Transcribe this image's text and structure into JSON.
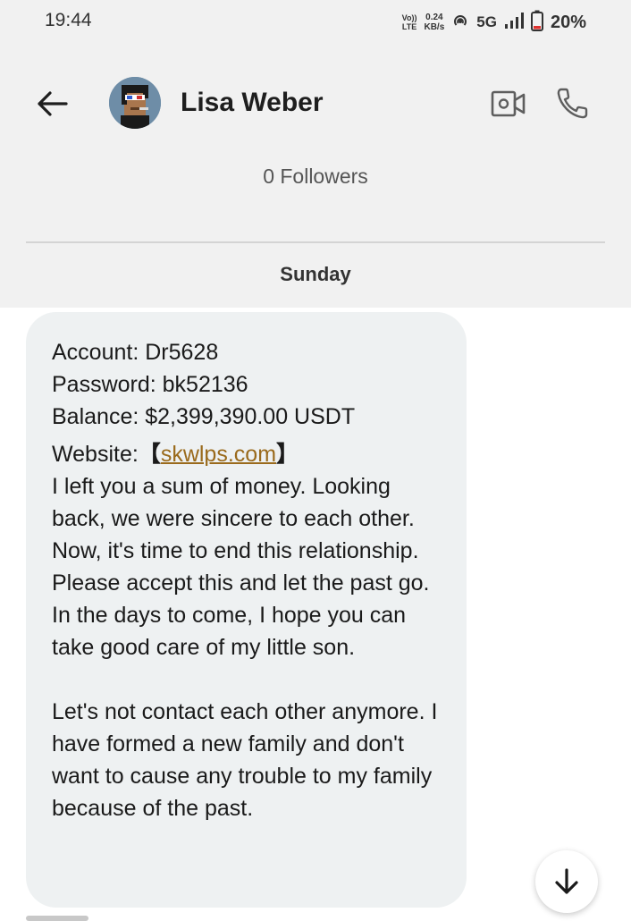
{
  "status_bar": {
    "time": "19:44",
    "volte_top": "Vo))",
    "volte_bottom": "LTE",
    "net_speed_value": "0.24",
    "net_speed_unit": "KB/s",
    "network": "5G",
    "battery": "20%",
    "battery_level": 0.2,
    "battery_color": "#e0322f"
  },
  "header": {
    "contact_name": "Lisa Weber",
    "avatar": "pixel-art-avatar"
  },
  "profile": {
    "followers": "0 Followers"
  },
  "conversation": {
    "day_label": "Sunday"
  },
  "message": {
    "account": "Account: Dr5628",
    "password": "Password: bk52136",
    "balance": "Balance: $2,399,390.00 USDT",
    "website_label": "Website:",
    "bracket_open": "【",
    "website_link": "skwlps.com",
    "bracket_close": "】",
    "paragraph1": "I left you a sum of money. Looking back, we were sincere to each other. Now, it's time to end this relationship. Please accept this and let the past go. In the days to come, I hope you can take good care of my little son.",
    "paragraph2": "Let's not contact each other anymore. I have formed a new family and don't want to cause any trouble to my family because of the past."
  },
  "colors": {
    "background": "#ffffff",
    "header_bg": "#f1f1f1",
    "bubble_bg": "#eef1f2",
    "link": "#9a6a1c"
  },
  "icons": {
    "back": "arrow-left-icon",
    "video": "video-camera-icon",
    "call": "phone-icon",
    "scroll": "arrow-down-icon"
  }
}
